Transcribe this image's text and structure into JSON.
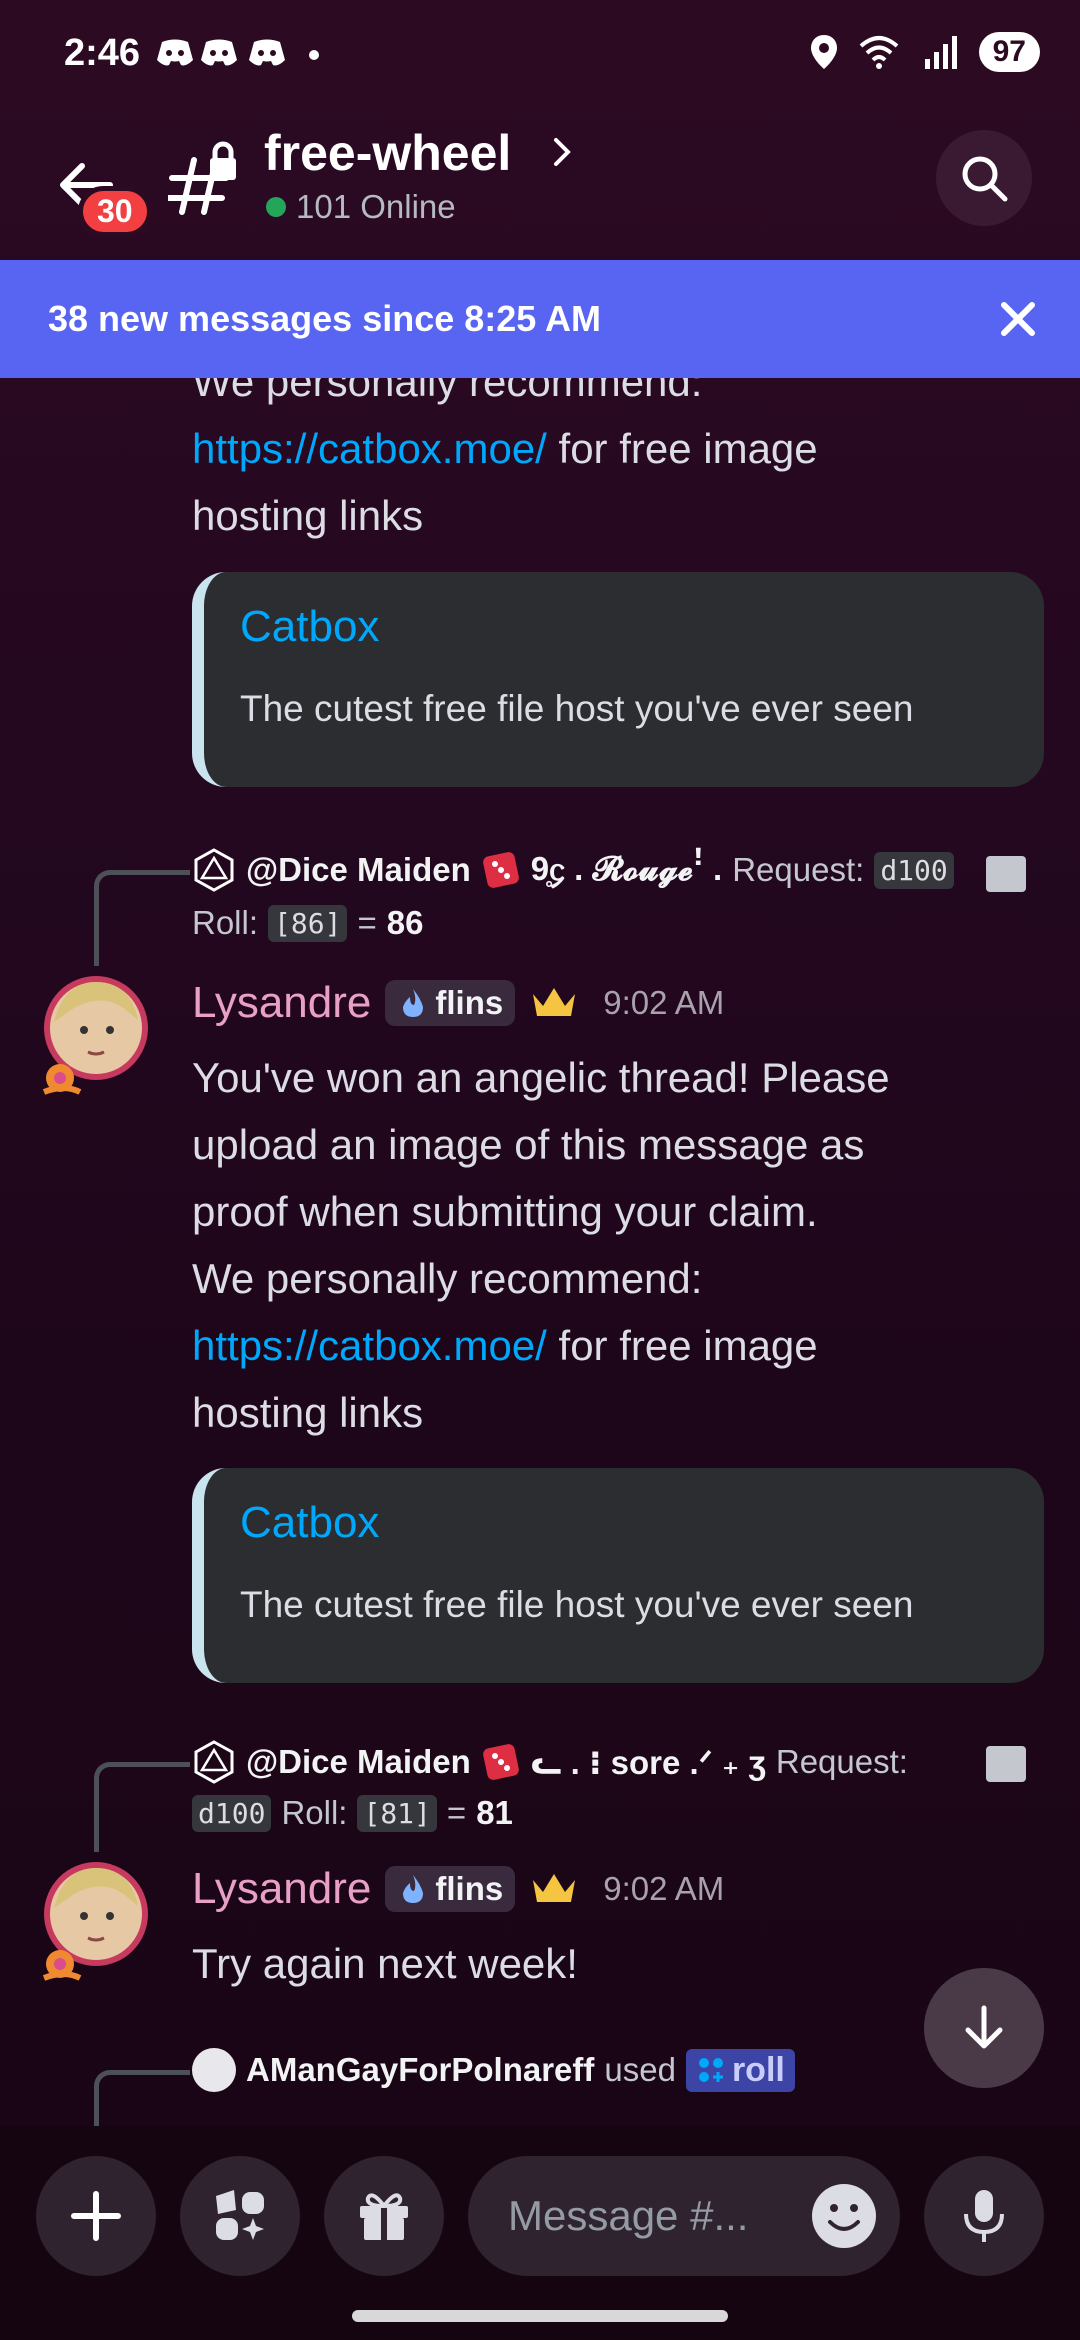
{
  "status_bar": {
    "time": "2:46",
    "battery": "97"
  },
  "header": {
    "back_badge": "30",
    "channel_name": "free-wheel",
    "online": "101 Online"
  },
  "new_messages_bar": {
    "text": "38 new messages since 8:25 AM"
  },
  "messages": {
    "cut_top": {
      "lines": [
        "We personally recommend:"
      ],
      "link": "https://catbox.moe/",
      "link_suffix": " for free image",
      "last_line": "hosting links",
      "embed": {
        "title": "Catbox",
        "description": "The cutest free file host you've ever seen"
      }
    },
    "msg1": {
      "reply": {
        "mention": "@Dice Maiden",
        "nick": "9̥᧔ . 𝓡𝓸𝓾𝓰𝓮ꜝ .",
        "request_label": "Request:",
        "request_code": "d100",
        "roll_label": "Roll:",
        "roll_code": "[86]",
        "roll_eq": "=",
        "roll_total": "86"
      },
      "author": "Lysandre",
      "role": "flins",
      "time": "9:02 AM",
      "lines": [
        "You've won an angelic thread! Please",
        "upload an image of this message as",
        "proof when submitting your claim.",
        "We personally recommend:"
      ],
      "link": "https://catbox.moe/",
      "link_suffix": " for free image",
      "last_line": "hosting links",
      "embed": {
        "title": "Catbox",
        "description": "The cutest free file host you've ever seen"
      }
    },
    "msg2": {
      "reply": {
        "mention": "@Dice Maiden",
        "nick": "ᓚ . ⁝ sore .ᐟ  ₊ ʒ",
        "request_label": "Request:",
        "request_code": "d100",
        "roll_label": "Roll:",
        "roll_code": "[81]",
        "roll_eq": "=",
        "roll_total": "81"
      },
      "author": "Lysandre",
      "role": "flins",
      "time": "9:02 AM",
      "text": "Try again next week!"
    },
    "msg3": {
      "reply_user": "AManGayForPolnareff",
      "reply_used": "used",
      "command": "roll"
    }
  },
  "composer": {
    "placeholder": "Message #..."
  },
  "colors": {
    "accent": "#5865f2",
    "link": "#00a8fc",
    "author": "#e8a0c6",
    "online": "#23a55a",
    "badge": "#f23f42"
  }
}
